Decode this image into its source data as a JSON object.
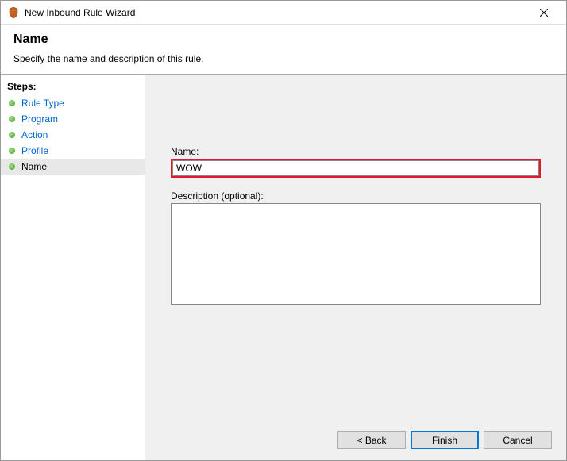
{
  "titlebar": {
    "title": "New Inbound Rule Wizard"
  },
  "header": {
    "title": "Name",
    "subtitle": "Specify the name and description of this rule."
  },
  "sidebar": {
    "title": "Steps:",
    "items": [
      {
        "label": "Rule Type",
        "current": false
      },
      {
        "label": "Program",
        "current": false
      },
      {
        "label": "Action",
        "current": false
      },
      {
        "label": "Profile",
        "current": false
      },
      {
        "label": "Name",
        "current": true
      }
    ]
  },
  "form": {
    "name_label": "Name:",
    "name_value": "WOW",
    "desc_label": "Description (optional):",
    "desc_value": ""
  },
  "buttons": {
    "back": "< Back",
    "finish": "Finish",
    "cancel": "Cancel"
  }
}
